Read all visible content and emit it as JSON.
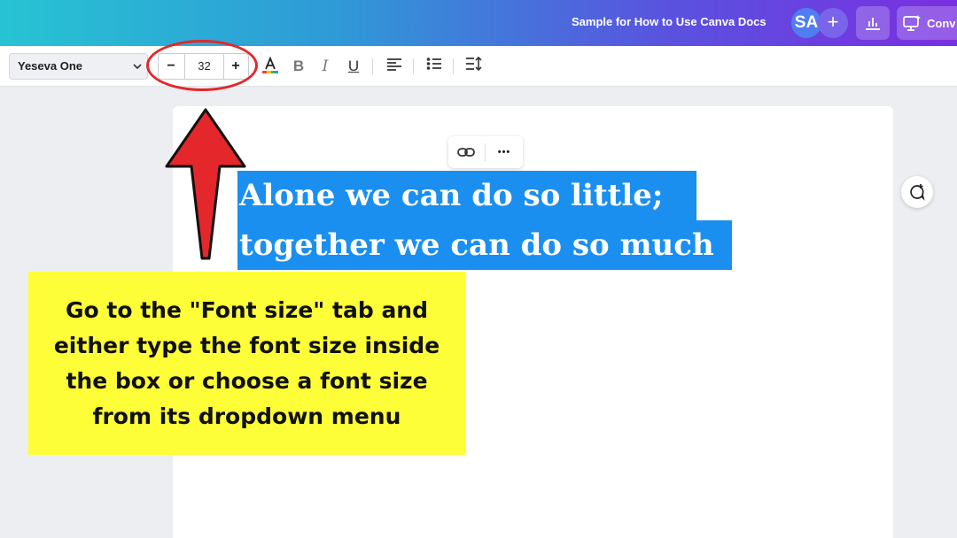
{
  "header": {
    "doc_title": "Sample for How to Use Canva Docs",
    "avatar_initials": "SA",
    "add_symbol": "+",
    "convert_label": "Conv"
  },
  "toolbar": {
    "font_family": "Yeseva One",
    "font_size": "32",
    "decrease_symbol": "−",
    "increase_symbol": "+",
    "bold_label": "B",
    "italic_label": "I",
    "underline_label": "U"
  },
  "document": {
    "quote_line_1": "Alone we can do so little;",
    "quote_line_2": "together we can do so much",
    "more_symbol": "•••"
  },
  "annotation": {
    "callout_text": "Go to the \"Font size\" tab and either type the font size inside the box or choose a font size from its dropdown menu"
  },
  "colors": {
    "selection": "#1b8fef",
    "callout_bg": "#fefe38",
    "arrow": "#e3272b"
  }
}
